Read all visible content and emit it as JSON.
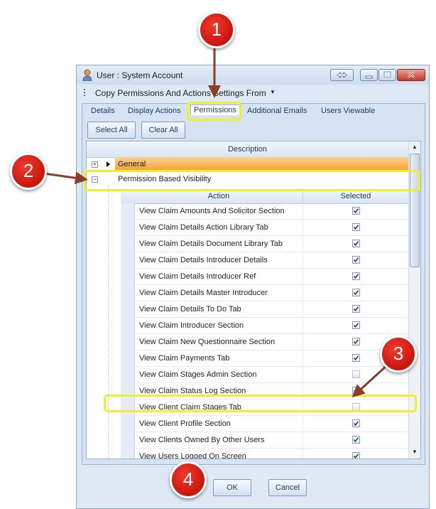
{
  "window": {
    "title": "User : System Account"
  },
  "menu": {
    "copy_label": "Copy Permissions And Actions Settings From"
  },
  "tabs": [
    "Details",
    "Display Actions",
    "Permissions",
    "Additional Emails",
    "Users Viewable"
  ],
  "toolbar": {
    "select_all": "Select All",
    "clear_all": "Clear All"
  },
  "grid": {
    "header": "Description",
    "groups": [
      "General",
      "Permission Based Visibility"
    ],
    "columns": {
      "action": "Action",
      "selected": "Selected"
    },
    "rows": [
      {
        "action": "View Claim Amounts And Solicitor Section",
        "selected": true
      },
      {
        "action": "View Claim Details Action Library Tab",
        "selected": true
      },
      {
        "action": "View Claim Details Document Library Tab",
        "selected": true
      },
      {
        "action": "View Claim Details Introducer Details",
        "selected": true
      },
      {
        "action": "View Claim Details Introducer Ref",
        "selected": true
      },
      {
        "action": "View Claim Details Master Introducer",
        "selected": true
      },
      {
        "action": "View Claim Details To Do Tab",
        "selected": true
      },
      {
        "action": "View Claim Introducer Section",
        "selected": true
      },
      {
        "action": "View Claim New Questionnaire Section",
        "selected": true
      },
      {
        "action": "View Claim Payments Tab",
        "selected": true
      },
      {
        "action": "View Claim Stages Admin Section",
        "selected": false
      },
      {
        "action": "View Claim Status Log Section",
        "selected": true
      },
      {
        "action": "View Client Claim Stages Tab",
        "selected": false
      },
      {
        "action": "View Client Profile Section",
        "selected": true
      },
      {
        "action": "View Clients Owned By Other Users",
        "selected": true
      },
      {
        "action": "View Users Logged On Screen",
        "selected": true
      }
    ]
  },
  "footer": {
    "ok": "OK",
    "cancel": "Cancel"
  },
  "callouts": [
    "1",
    "2",
    "3",
    "4"
  ],
  "colors": {
    "callout": "#d41f14",
    "highlight": "#f2ee2c",
    "general_row": "#f79a3a"
  }
}
